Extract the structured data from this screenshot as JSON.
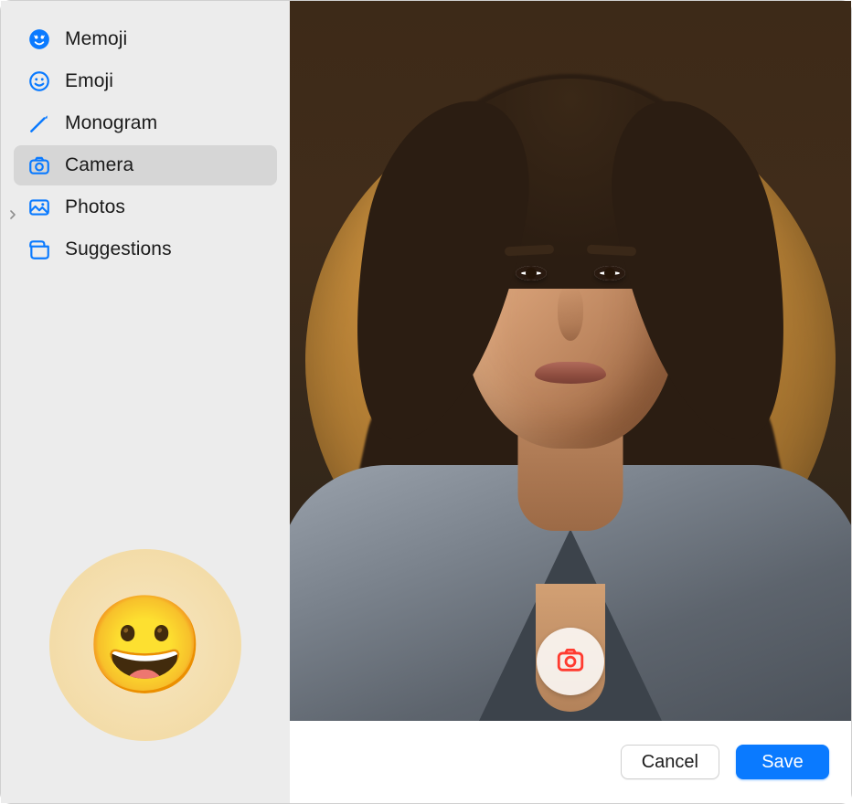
{
  "sidebar": {
    "items": [
      {
        "label": "Memoji",
        "icon": "memoji-icon",
        "selected": false,
        "expandable": false
      },
      {
        "label": "Emoji",
        "icon": "emoji-icon",
        "selected": false,
        "expandable": false
      },
      {
        "label": "Monogram",
        "icon": "monogram-icon",
        "selected": false,
        "expandable": false
      },
      {
        "label": "Camera",
        "icon": "camera-icon",
        "selected": true,
        "expandable": false
      },
      {
        "label": "Photos",
        "icon": "photos-icon",
        "selected": false,
        "expandable": true
      },
      {
        "label": "Suggestions",
        "icon": "suggestions-icon",
        "selected": false,
        "expandable": false
      }
    ]
  },
  "current_avatar_emoji": "😀",
  "footer": {
    "cancel_label": "Cancel",
    "save_label": "Save"
  }
}
